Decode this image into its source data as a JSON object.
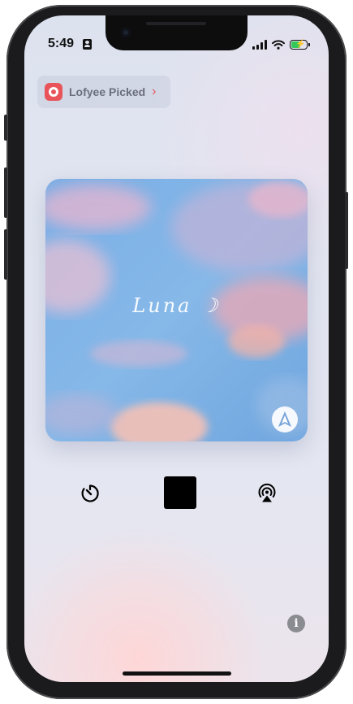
{
  "status_bar": {
    "time": "5:49",
    "person_icon": "person-card-icon",
    "signal_icon": "cellular-signal-icon",
    "wifi_icon": "wifi-icon",
    "battery_icon": "battery-charging-icon",
    "battery_color": "#34c759"
  },
  "source_chip": {
    "app_icon": "lofyee-app-icon",
    "label": "Lofyee Picked",
    "chevron": "›",
    "accent_color": "#e9545b"
  },
  "artwork": {
    "title": "Luna",
    "moon_glyph": "☽",
    "badge_icon": "app-badge-a-icon"
  },
  "controls": {
    "timer_icon": "timer-icon",
    "stop_icon": "stop-icon",
    "airplay_icon": "airplay-audio-icon"
  },
  "info": {
    "glyph": "i",
    "icon": "info-icon"
  }
}
